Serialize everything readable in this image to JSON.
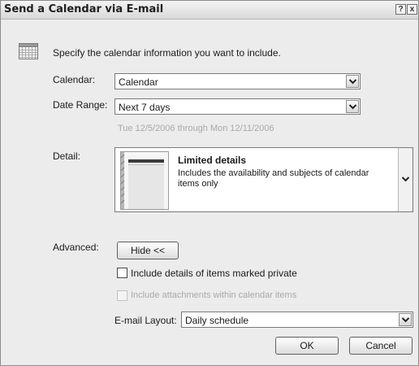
{
  "window": {
    "title": "Send a Calendar via E-mail"
  },
  "titlebar_buttons": {
    "help": "?",
    "close": "x"
  },
  "intro": {
    "text": "Specify the calendar information you want to include.",
    "icon": "calendar-grid-icon"
  },
  "calendar": {
    "label": "Calendar:",
    "value": "Calendar"
  },
  "date_range": {
    "label": "Date Range:",
    "value": "Next 7 days",
    "hint": "Tue 12/5/2006 through Mon 12/11/2006"
  },
  "detail": {
    "label": "Detail:",
    "title": "Limited details",
    "description": "Includes the availability and subjects of calendar items only"
  },
  "advanced": {
    "label": "Advanced:",
    "toggle_label": "Hide <<"
  },
  "options": {
    "private_label": "Include details of items marked private",
    "attachments_label": "Include attachments within calendar items"
  },
  "email_layout": {
    "label": "E-mail Layout:",
    "value": "Daily schedule"
  },
  "buttons": {
    "ok": "OK",
    "cancel": "Cancel"
  }
}
